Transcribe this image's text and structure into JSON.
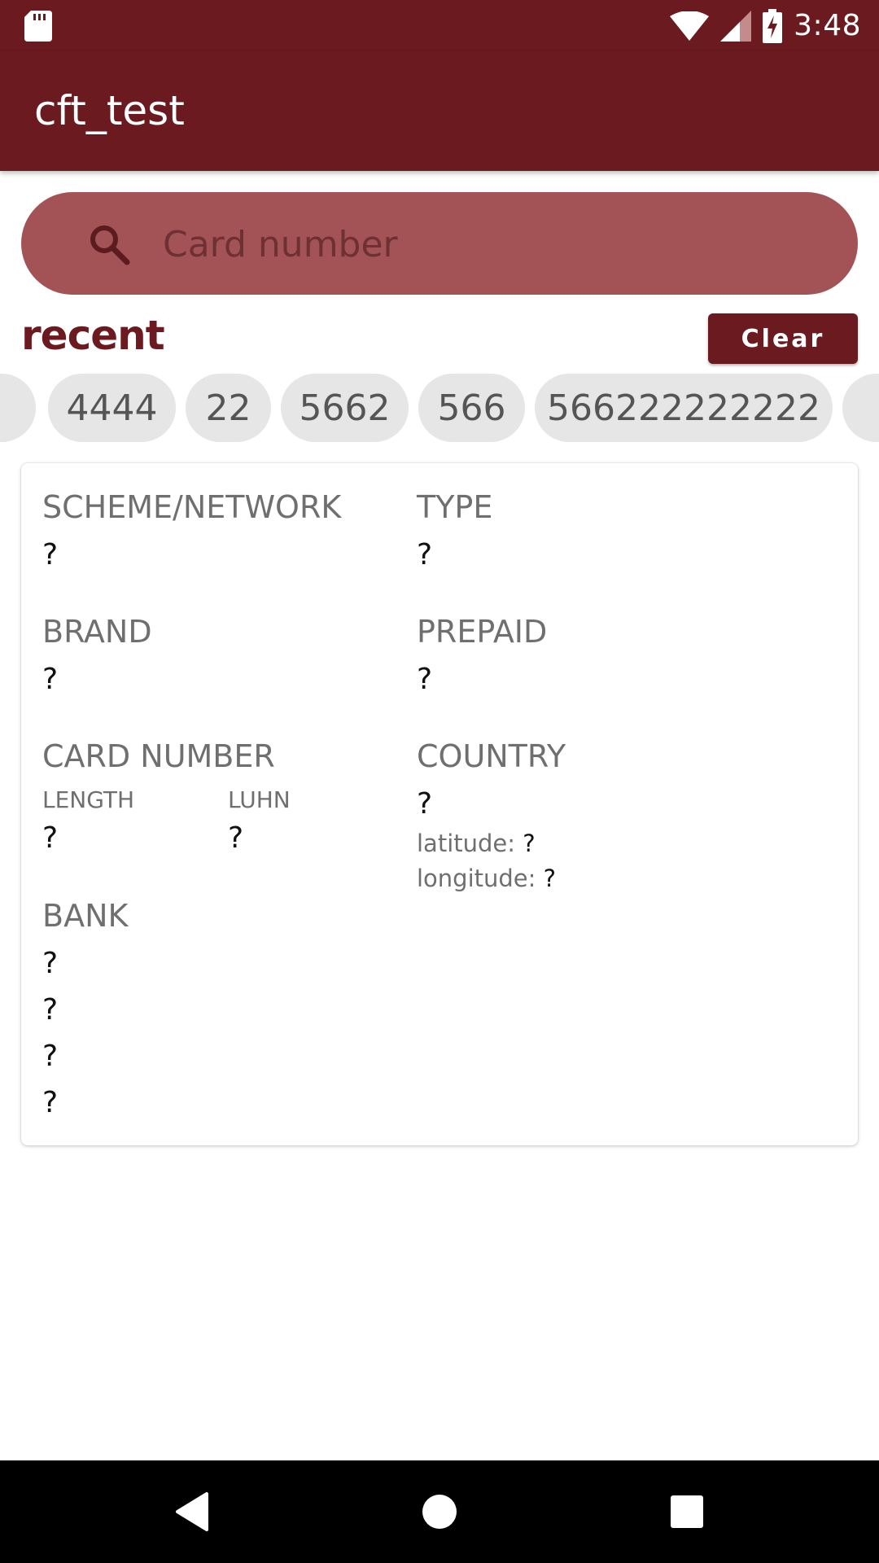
{
  "status_bar": {
    "time": "3:48"
  },
  "app_bar": {
    "title": "cft_test"
  },
  "search": {
    "placeholder": "Card number"
  },
  "recent": {
    "label": "recent",
    "clear_label": "Clear",
    "chips": [
      "4444",
      "22",
      "5662",
      "566",
      "566222222222"
    ]
  },
  "card": {
    "scheme_label": "SCHEME/NETWORK",
    "scheme_value": "?",
    "type_label": "TYPE",
    "type_value": "?",
    "brand_label": "BRAND",
    "brand_value": "?",
    "prepaid_label": "PREPAID",
    "prepaid_value": "?",
    "card_number_label": "CARD NUMBER",
    "length_label": "LENGTH",
    "length_value": "?",
    "luhn_label": "LUHN",
    "luhn_value": "?",
    "country_label": "COUNTRY",
    "country_value": "?",
    "latitude_label": "latitude:",
    "latitude_value": "?",
    "longitude_label": "longitude:",
    "longitude_value": "?",
    "bank_label": "BANK",
    "bank_values": [
      "?",
      "?",
      "?",
      "?"
    ]
  },
  "colors": {
    "primary": "#6b1a1f",
    "search_bg": "#a35355",
    "chip_bg": "#e6e6e6"
  }
}
